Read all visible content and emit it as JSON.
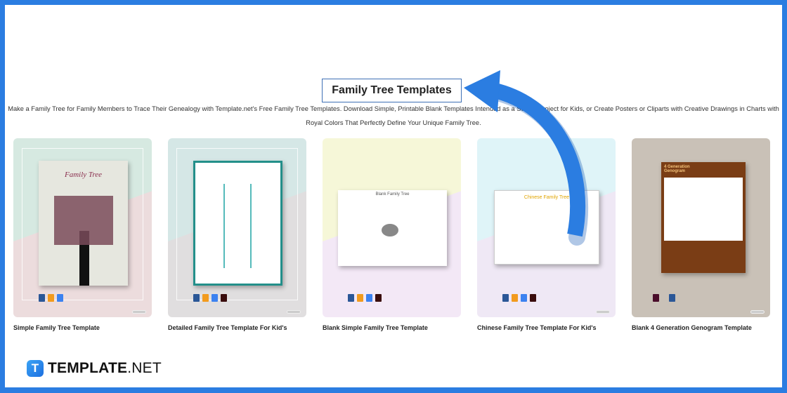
{
  "header": {
    "title": "Family Tree Templates",
    "description": "Make a Family Tree for Family Members to Trace Their Genealogy with Template.net's Free Family Tree Templates. Download Simple, Printable Blank Templates Intended as a School Project for Kids, or Create Posters or Cliparts with Creative Drawings in Charts with Royal Colors That Perfectly Define Your Unique Family Tree."
  },
  "cards": [
    {
      "title": "Simple Family Tree Template",
      "thumb_text": "Family Tree",
      "formats": [
        "word-icon",
        "pages-icon",
        "google-docs-icon"
      ]
    },
    {
      "title": "Detailed Family Tree Template For Kid's",
      "formats": [
        "word-icon",
        "pages-icon",
        "google-docs-icon",
        "pdf-icon"
      ]
    },
    {
      "title": "Blank Simple Family Tree Template",
      "thumb_text": "Blank Family Tree",
      "formats": [
        "word-icon",
        "pages-icon",
        "google-docs-icon",
        "pdf-icon"
      ]
    },
    {
      "title": "Chinese Family Tree Template For Kid's",
      "thumb_text": "Chinese Family Tree",
      "formats": [
        "word-icon",
        "pages-icon",
        "google-docs-icon",
        "pdf-icon"
      ]
    },
    {
      "title": "Blank 4 Generation Genogram Template",
      "thumb_text": "4 Generation Genogram",
      "formats": [
        "indesign-icon",
        "word-icon"
      ]
    }
  ],
  "logo": {
    "bold": "TEMPLATE",
    "light": ".NET",
    "mark": "T"
  },
  "colors": {
    "border": "#2b7de1",
    "arrow": "#2b7de1"
  }
}
